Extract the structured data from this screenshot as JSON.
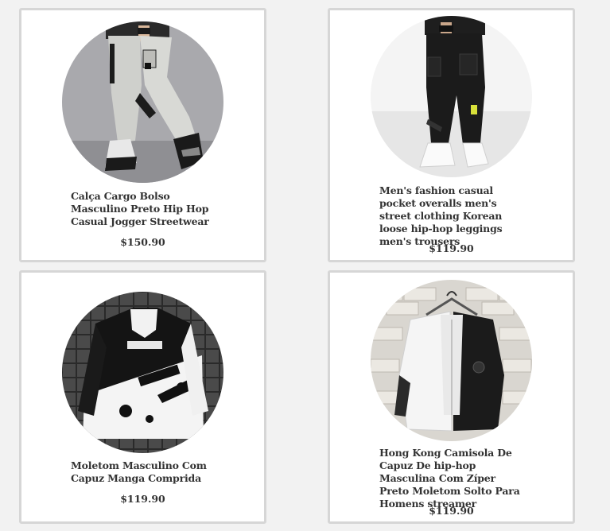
{
  "products": [
    {
      "title": "Calça Cargo Bolso Masculino Preto Hip Hop Casual Jogger Streetwear",
      "price": "$150.90",
      "image_icon": "gray-cargo-pants-photo"
    },
    {
      "title": "Men's fashion casual pocket overalls men's street clothing Korean loose hip-hop leggings men's trousers",
      "price": "$119.90",
      "image_icon": "black-cargo-pants-photo"
    },
    {
      "title": "Moletom Masculino Com Capuz Manga Comprida",
      "price": "$119.90",
      "image_icon": "black-white-hoodie-photo"
    },
    {
      "title": "Hong Kong Camisola De Capuz De hip-hop Masculina Com Zíper Preto Moletom Solto Para Homens streamer",
      "price": "$119.90",
      "image_icon": "layered-jacket-photo"
    }
  ],
  "colors": {
    "page_bg": "#f2f2f2",
    "card_bg": "#ffffff",
    "card_border": "#d6d6d6",
    "text": "#333333"
  }
}
